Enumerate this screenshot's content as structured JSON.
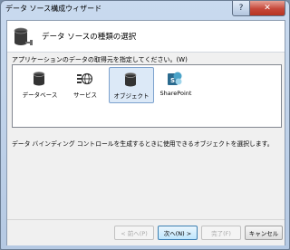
{
  "window": {
    "title": "データ ソース構成ウィザード",
    "help_glyph": "?",
    "close_glyph": "✕"
  },
  "header": {
    "title": "データ ソースの種類の選択",
    "icon": "database-plug-icon"
  },
  "main": {
    "instruction": "アプリケーションのデータの取得元を指定してください。(W)",
    "items": [
      {
        "label": "データベース",
        "icon": "database-icon"
      },
      {
        "label": "サービス",
        "icon": "service-icon"
      },
      {
        "label": "オブジェクト",
        "icon": "object-icon",
        "selected": true
      },
      {
        "label": "SharePoint",
        "icon": "sharepoint-icon"
      }
    ],
    "description": "データ バインディング コントロールを生成するときに使用できるオブジェクトを選択します。"
  },
  "footer": {
    "prev_label": "< 前へ(P)",
    "next_label": "次へ(N) >",
    "finish_label": "完了(F)",
    "cancel_label": "キャンセル"
  },
  "colors": {
    "accent": "#3c7fb1",
    "selection": "#dce9f7"
  }
}
